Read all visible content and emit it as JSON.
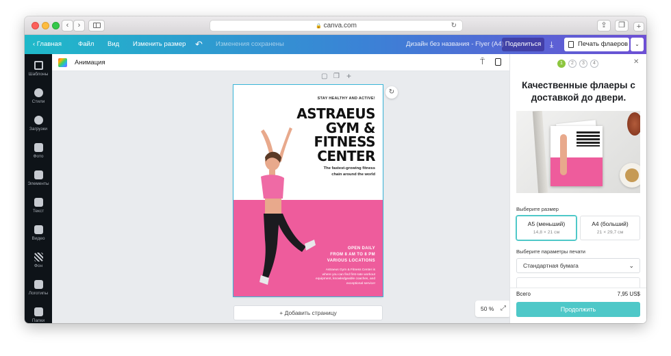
{
  "browser": {
    "url": "canva.com",
    "lock_glyph": "🔒"
  },
  "topbar": {
    "back_label": "‹  Главная",
    "file_label": "Файл",
    "view_label": "Вид",
    "resize_label": "Изменить размер",
    "undo_glyph": "↶",
    "saved_status": "Изменения сохранены",
    "design_title": "Дизайн без названия - Flyer (A4)",
    "share_label": "Поделиться",
    "download_glyph": "⤓",
    "print_label": "Печать флаеров",
    "dropdown_glyph": "⌄"
  },
  "sidebar": {
    "items": [
      {
        "label": "Шаблоны",
        "icon": "templates-icon"
      },
      {
        "label": "Стили",
        "icon": "styles-icon"
      },
      {
        "label": "Загрузки",
        "icon": "uploads-icon"
      },
      {
        "label": "Фото",
        "icon": "photo-icon"
      },
      {
        "label": "Элементы",
        "icon": "elements-icon"
      },
      {
        "label": "Текст",
        "icon": "text-icon"
      },
      {
        "label": "Видео",
        "icon": "video-icon"
      },
      {
        "label": "Фон",
        "icon": "background-icon"
      },
      {
        "label": "Логотипы",
        "icon": "logos-icon"
      },
      {
        "label": "Папки",
        "icon": "folders-icon"
      }
    ]
  },
  "toolbar": {
    "animation_label": "Анимация"
  },
  "flyer": {
    "tagline": "STAY HEALTHY AND ACTIVE!",
    "title_line1": "ASTRAEUS",
    "title_line2": "GYM &",
    "title_line3": "FITNESS",
    "title_line4": "CENTER",
    "subtitle_line1": "The fastest-growing fitness",
    "subtitle_line2": "chain around the world",
    "open_line1": "OPEN DAILY",
    "open_line2": "FROM 8 AM TO 8 PM",
    "open_line3": "VARIOUS LOCATIONS",
    "desc_line1": "Astraeus Gym & Fitness Center is",
    "desc_line2": "where you can find first-rate workout",
    "desc_line3": "equipment, knowledgeable coaches, and",
    "desc_line4": "exceptional service!"
  },
  "canvas": {
    "add_page_label": "+ Добавить страницу",
    "zoom_label": "50 %",
    "help_label": "?"
  },
  "panel": {
    "steps": [
      "1",
      "2",
      "3",
      "4"
    ],
    "close_glyph": "✕",
    "title_line1": "Качественные флаеры с",
    "title_line2": "доставкой до двери.",
    "size_heading": "Выберите размер",
    "size_a5_title": "A5 (меньший)",
    "size_a5_dims": "14,8 × 21 см",
    "size_a4_title": "A4 (больший)",
    "size_a4_dims": "21 × 29,7 см",
    "print_params_heading": "Выберите параметры печати",
    "paper_selected": "Стандартная бумага",
    "total_label": "Всего",
    "total_value": "7,95 US$",
    "continue_label": "Продолжить"
  },
  "colors": {
    "accent_purple": "#7d2ae8",
    "flyer_pink": "#ee5c9c",
    "continue_teal": "#4ec8c8",
    "step_active": "#8dc63f"
  }
}
